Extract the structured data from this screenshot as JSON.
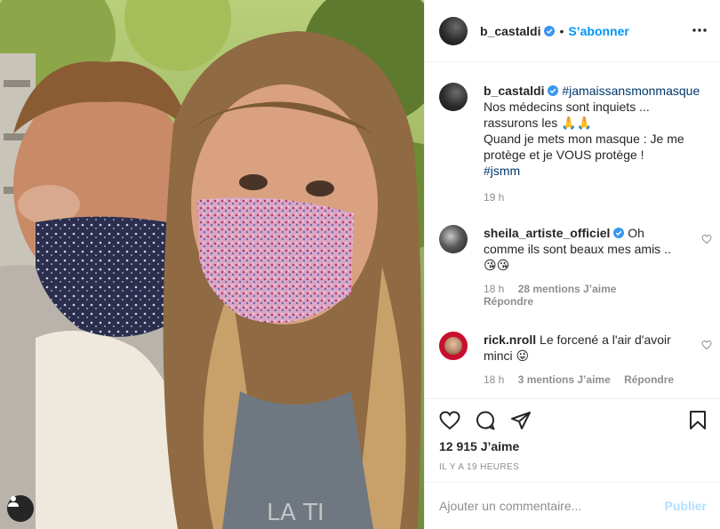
{
  "header": {
    "username": "b_castaldi",
    "separator": "•",
    "follow_label": "S’abonner",
    "more_icon": "more-horizontal-icon"
  },
  "caption": {
    "username": "b_castaldi",
    "hashtag": "#jamaissansmonmasque",
    "line1": "Nos médecins sont inquiets ...",
    "line2": "rassurons les 🙏🙏",
    "line3": "Quand je mets mon masque : Je me protège et je VOUS protège !",
    "hashtag2": "#jsmm",
    "time": "19 h"
  },
  "comments": [
    {
      "username": "sheila_artiste_officiel",
      "verified": true,
      "text": "Oh comme ils sont beaux mes amis .. 😘😘",
      "time": "18 h",
      "likes": "28 mentions J’aime",
      "reply": "Répondre"
    },
    {
      "username": "rick.nroll",
      "verified": false,
      "text": "Le forcené a l'air d'avoir minci 😜",
      "time": "18 h",
      "likes": "3 mentions J’aime",
      "reply": "Répondre"
    }
  ],
  "actions": {
    "like_icon": "heart-icon",
    "comment_icon": "comment-icon",
    "share_icon": "paper-plane-icon",
    "save_icon": "bookmark-icon"
  },
  "likes_count": "12 915 J’aime",
  "posted_time": "IL Y A 19 HEURES",
  "add_comment": {
    "placeholder": "Ajouter un commentaire...",
    "publish_label": "Publier"
  },
  "colors": {
    "accent": "#0095f6",
    "verified": "#3897f0",
    "publish_disabled": "#b2dffc",
    "muted": "#8e8e8e",
    "hashtag": "#00376b"
  }
}
